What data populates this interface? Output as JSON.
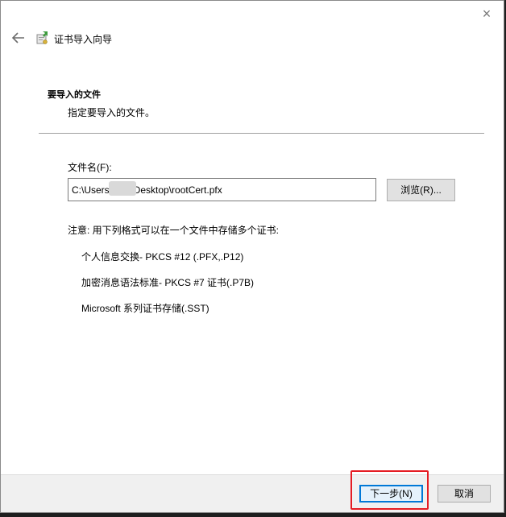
{
  "window": {
    "title": "证书导入向导",
    "close_symbol": "×"
  },
  "icons": {
    "back": "back-arrow-icon",
    "wizard": "certificate-wizard-icon",
    "close": "close-icon"
  },
  "page": {
    "heading": "要导入的文件",
    "subheading": "指定要导入的文件。"
  },
  "file": {
    "label": "文件名(F):",
    "value": "C:\\Users\\        Desktop\\rootCert.pfx",
    "browse_label": "浏览(R)..."
  },
  "note": "注意: 用下列格式可以在一个文件中存储多个证书:",
  "formats": [
    "个人信息交换- PKCS #12 (.PFX,.P12)",
    "加密消息语法标准- PKCS #7 证书(.P7B)",
    "Microsoft 系列证书存储(.SST)"
  ],
  "footer": {
    "next_label": "下一步(N)",
    "cancel_label": "取消"
  },
  "colors": {
    "accent": "#0078d7",
    "highlight": "#e51c23",
    "footer_bg": "#f0f0f0"
  }
}
